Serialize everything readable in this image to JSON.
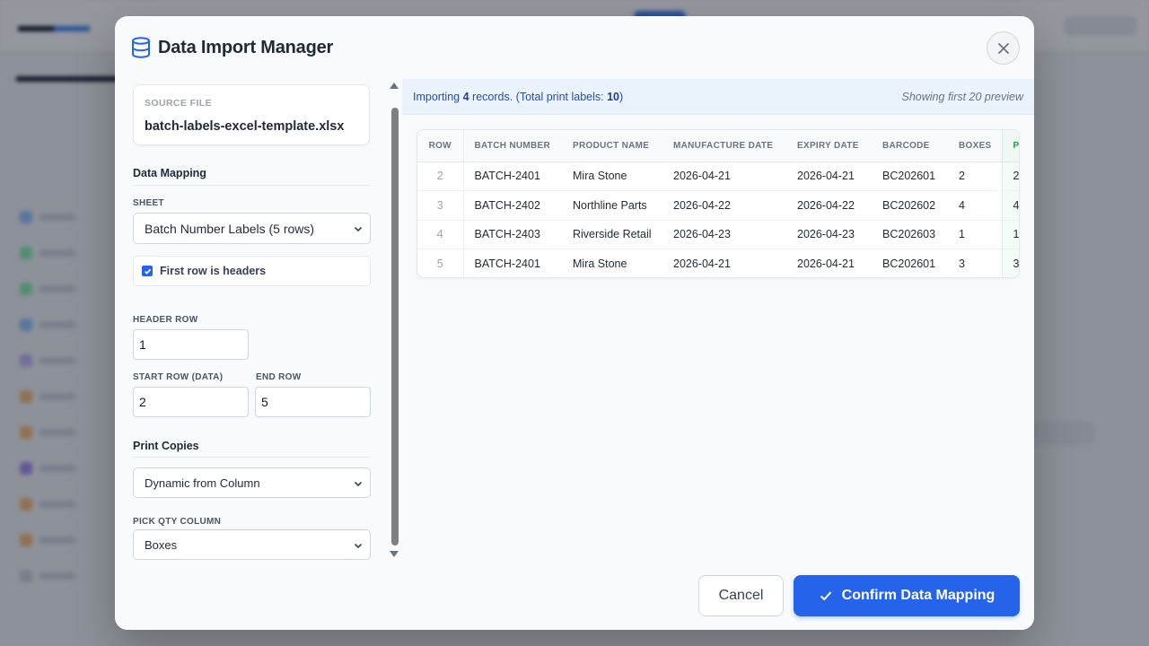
{
  "background": {
    "colors": {
      "accent": "#3b82f6"
    },
    "side_icon_colors": [
      "#93c5fd",
      "#86efac",
      "#86efac",
      "#93c5fd",
      "#c4b5fd",
      "#fdba74",
      "#fdba74",
      "#a78bfa",
      "#fdba74",
      "#fdba74",
      "#cbd5e1"
    ]
  },
  "modal": {
    "title": "Data Import Manager",
    "title_icon": "database-icon",
    "close_icon": "close-icon"
  },
  "source": {
    "caption": "SOURCE FILE",
    "filename": "batch-labels-excel-template.xlsx"
  },
  "mapping": {
    "section_title": "Data Mapping",
    "sheet_label": "SHEET",
    "sheet_value": "Batch Number Labels (5 rows)",
    "first_row_headers_label": "First row is headers",
    "first_row_headers_checked": true,
    "header_row_label": "HEADER ROW",
    "header_row_value": "1",
    "start_row_label": "START ROW (DATA)",
    "start_row_value": "2",
    "end_row_label": "END ROW",
    "end_row_value": "5"
  },
  "print": {
    "section_title": "Print Copies",
    "mode_value": "Dynamic from Column",
    "qty_column_label": "PICK QTY COLUMN",
    "qty_column_value": "Boxes"
  },
  "summary": {
    "prefix": "Importing",
    "record_count": "4",
    "middle": "records. (Total print labels:",
    "label_count": "10",
    "suffix": ")",
    "preview_note": "Showing first 20 preview"
  },
  "table": {
    "headers": [
      "ROW",
      "BATCH NUMBER",
      "PRODUCT NAME",
      "MANUFACTURE DATE",
      "EXPIRY DATE",
      "BARCODE",
      "BOXES",
      "PRINT COPIES"
    ],
    "rows": [
      {
        "row": "2",
        "batch": "BATCH-2401",
        "product": "Mira Stone",
        "mfg": "2026-04-21",
        "expiry": "2026-04-21",
        "barcode": "BC202601",
        "boxes": "2",
        "copies": "2"
      },
      {
        "row": "3",
        "batch": "BATCH-2402",
        "product": "Northline Parts",
        "mfg": "2026-04-22",
        "expiry": "2026-04-22",
        "barcode": "BC202602",
        "boxes": "4",
        "copies": "4"
      },
      {
        "row": "4",
        "batch": "BATCH-2403",
        "product": "Riverside Retail",
        "mfg": "2026-04-23",
        "expiry": "2026-04-23",
        "barcode": "BC202603",
        "boxes": "1",
        "copies": "1"
      },
      {
        "row": "5",
        "batch": "BATCH-2401",
        "product": "Mira Stone",
        "mfg": "2026-04-21",
        "expiry": "2026-04-21",
        "barcode": "BC202601",
        "boxes": "3",
        "copies": "3"
      }
    ]
  },
  "footer": {
    "cancel_label": "Cancel",
    "confirm_label": "Confirm Data Mapping",
    "confirm_icon": "check-icon"
  },
  "colors": {
    "primary": "#2563eb",
    "info_bg": "#eaf2fc",
    "info_text": "#2150a8",
    "extra_col": "#16a34a"
  }
}
